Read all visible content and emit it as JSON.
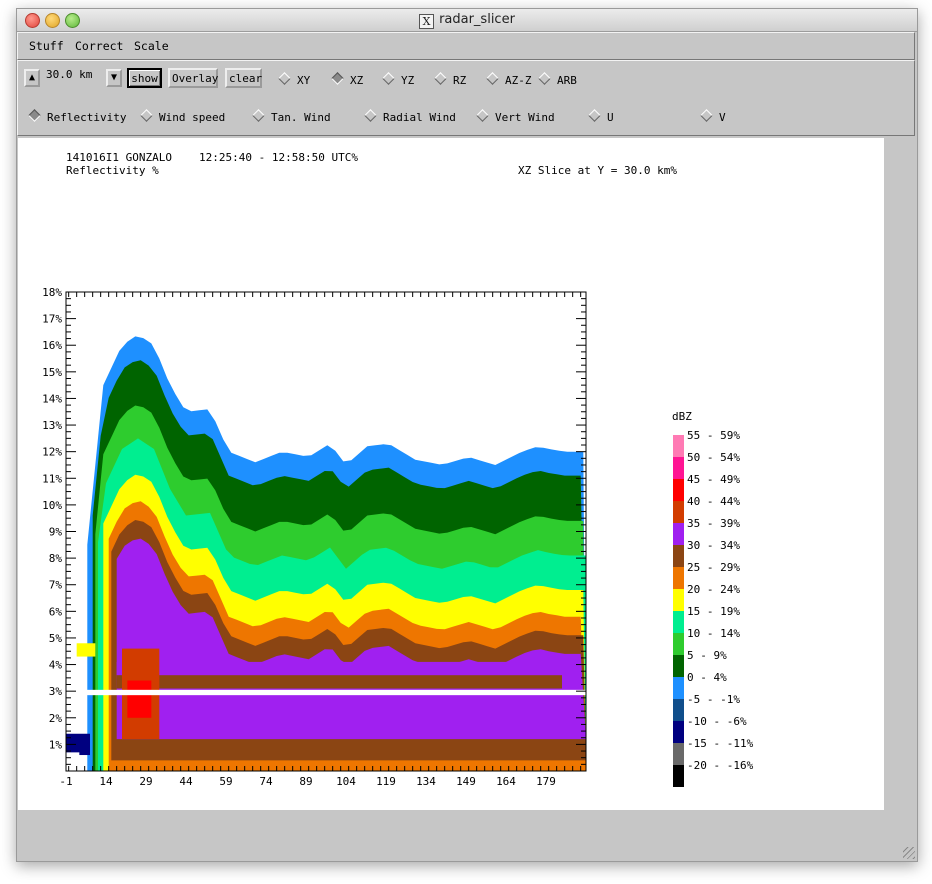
{
  "window": {
    "title": "radar_slicer"
  },
  "menu": [
    "Stuff",
    "Correct",
    "Scale"
  ],
  "toolbar": {
    "slice_value": "30.0 km",
    "show_label": "show",
    "overlay_label": "Overlay",
    "clear_label": "clear",
    "slice_modes": [
      {
        "label": "XY",
        "selected": false
      },
      {
        "label": "XZ",
        "selected": true
      },
      {
        "label": "YZ",
        "selected": false
      },
      {
        "label": "RZ",
        "selected": false
      },
      {
        "label": "AZ-Z",
        "selected": false
      },
      {
        "label": "ARB",
        "selected": false
      }
    ],
    "fields": [
      {
        "label": "Reflectivity",
        "selected": true
      },
      {
        "label": "Wind speed",
        "selected": false
      },
      {
        "label": "Tan. Wind",
        "selected": false
      },
      {
        "label": "Radial Wind",
        "selected": false
      },
      {
        "label": "Vert Wind",
        "selected": false
      },
      {
        "label": "U",
        "selected": false
      },
      {
        "label": "V",
        "selected": false
      }
    ]
  },
  "plot": {
    "flight": "141016I1 GONZALO",
    "time_range": "12:25:40 - 12:58:50 UTC%",
    "field_name": "Reflectivity %",
    "slice_desc": "XZ Slice at Y = 30.0 km%"
  },
  "legend": {
    "title": "dBZ",
    "entries": [
      {
        "label": "55 - 59%",
        "color": "#ff7ab4"
      },
      {
        "label": "50 - 54%",
        "color": "#ff1493"
      },
      {
        "label": "45 - 49%",
        "color": "#ff0000"
      },
      {
        "label": "40 - 44%",
        "color": "#d23c00"
      },
      {
        "label": "35 - 39%",
        "color": "#a020f0"
      },
      {
        "label": "30 - 34%",
        "color": "#8b4513"
      },
      {
        "label": "25 - 29%",
        "color": "#ee7600"
      },
      {
        "label": "20 - 24%",
        "color": "#ffff00"
      },
      {
        "label": "15 - 19%",
        "color": "#00ee90"
      },
      {
        "label": "10 - 14%",
        "color": "#2ecc2e"
      },
      {
        "label": "5 - 9%",
        "color": "#006400"
      },
      {
        "label": "0 - 4%",
        "color": "#1e90ff"
      },
      {
        "label": "-5 - -1%",
        "color": "#104e8b"
      },
      {
        "label": "-10 - -6%",
        "color": "#000080"
      },
      {
        "label": "-15 - -11%",
        "color": "#696969"
      },
      {
        "label": "-20 - -16%",
        "color": "#000000"
      }
    ]
  },
  "chart_data": {
    "type": "heatmap",
    "xlim": [
      -1,
      194
    ],
    "ylim": [
      0,
      18
    ],
    "x_ticks": [
      "-1",
      "14",
      "29",
      "44",
      "59",
      "74",
      "89",
      "104",
      "119",
      "134",
      "149",
      "164",
      "179"
    ],
    "y_ticks": [
      "1%",
      "2%",
      "3%",
      "4%",
      "5%",
      "6%",
      "7%",
      "8%",
      "9%",
      "10%",
      "11%",
      "12%",
      "13%",
      "14%",
      "15%",
      "16%",
      "17%",
      "18%"
    ],
    "echo_top_profile": [
      [
        7,
        8.5
      ],
      [
        13,
        14.5
      ],
      [
        20,
        16
      ],
      [
        26,
        16.4
      ],
      [
        32,
        16
      ],
      [
        38,
        14.5
      ],
      [
        44,
        13.5
      ],
      [
        53,
        13.6
      ],
      [
        60,
        12
      ],
      [
        70,
        11.6
      ],
      [
        80,
        12
      ],
      [
        90,
        11.8
      ],
      [
        98,
        12.3
      ],
      [
        104,
        11.5
      ],
      [
        112,
        12.2
      ],
      [
        120,
        12.3
      ],
      [
        130,
        11.7
      ],
      [
        140,
        11.5
      ],
      [
        150,
        11.8
      ],
      [
        160,
        11.5
      ],
      [
        170,
        12
      ],
      [
        176,
        12.2
      ],
      [
        180,
        12.1
      ],
      [
        186,
        12
      ]
    ],
    "data_gap_altitude": 3
  }
}
